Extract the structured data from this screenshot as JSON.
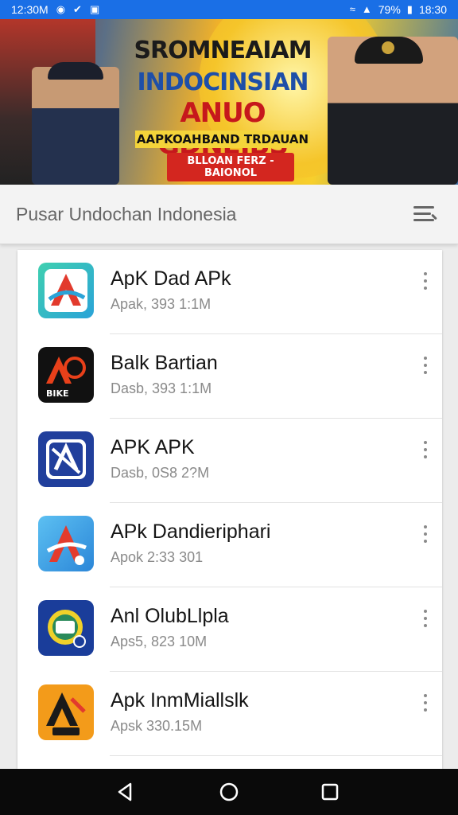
{
  "status_bar": {
    "time_left": "12:30M",
    "battery": "79%",
    "time_right": "18:30"
  },
  "banner": {
    "line1": "SROMNEAIAM",
    "line2": "INDOCINSIAN",
    "line3": "ANUO GDNEIBS",
    "line4": "AAPKOAHBAND TRDAUAN",
    "line5": "BLLOAN FERZ -BAIONOL"
  },
  "app_bar": {
    "title": "Pusar Undochan Indonesia",
    "menu_icon": "menu-icon"
  },
  "apps": [
    {
      "name": "ApK Dad APk",
      "sub": "Apak, 393 1:1M",
      "icon": "app-icon-a-teal",
      "icon_colors": [
        "#2aa3d8",
        "#3fd0b0"
      ]
    },
    {
      "name": "Balk Bartian",
      "sub": "Dasb, 393 1:1M",
      "icon": "app-icon-a-black",
      "icon_colors": [
        "#111111",
        "#e8401a"
      ]
    },
    {
      "name": "APK APK",
      "sub": "Dasb, 0S8 2?M",
      "icon": "app-icon-a-blue",
      "icon_colors": [
        "#213f9c",
        "#ffffff"
      ]
    },
    {
      "name": "APk Dandieriphari",
      "sub": "Apok 2:33 301",
      "icon": "app-icon-a-sky",
      "icon_colors": [
        "#38a0e8",
        "#e33b2d"
      ]
    },
    {
      "name": "Anl OlubLlpla",
      "sub": "Aps5, 823 10M",
      "icon": "app-icon-chat",
      "icon_colors": [
        "#1a3d9a",
        "#f0d12a"
      ]
    },
    {
      "name": "Apk InmMiallslk",
      "sub": "Apsk 330.15M",
      "icon": "app-icon-a-orange",
      "icon_colors": [
        "#f39b1a",
        "#1a1a1a"
      ]
    }
  ],
  "nav": {
    "back_icon": "back-icon",
    "home_icon": "home-icon",
    "recents_icon": "recents-icon"
  }
}
